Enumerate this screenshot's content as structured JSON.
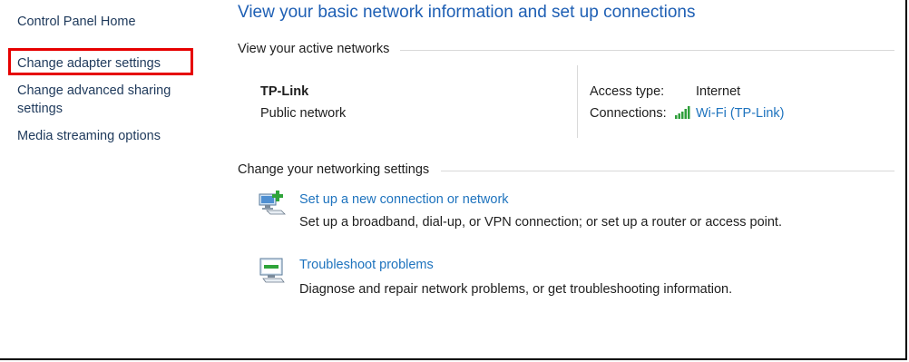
{
  "sidebar": {
    "items": [
      {
        "label": "Control Panel Home"
      },
      {
        "label": "Change adapter settings"
      },
      {
        "label": "Change advanced sharing settings"
      },
      {
        "label": "Media streaming options"
      }
    ]
  },
  "main": {
    "title": "View your basic network information and set up connections",
    "active_networks": {
      "heading": "View your active networks",
      "network_name": "TP-Link",
      "network_category": "Public network",
      "access_type_label": "Access type:",
      "access_type_value": "Internet",
      "connections_label": "Connections:",
      "connection_link": "Wi-Fi (TP-Link)",
      "connection_icon": "wifi-signal-icon"
    },
    "change_settings": {
      "heading": "Change your networking settings",
      "tasks": [
        {
          "icon": "new-connection-icon",
          "link": "Set up a new connection or network",
          "description": "Set up a broadband, dial-up, or VPN connection; or set up a router or access point."
        },
        {
          "icon": "troubleshoot-icon",
          "link": "Troubleshoot problems",
          "description": "Diagnose and repair network problems, or get troubleshooting information."
        }
      ]
    }
  },
  "colors": {
    "title": "#1e5fb4",
    "link": "#1e73be",
    "sidebar_link": "#1e395b",
    "highlight": "#e60000"
  }
}
